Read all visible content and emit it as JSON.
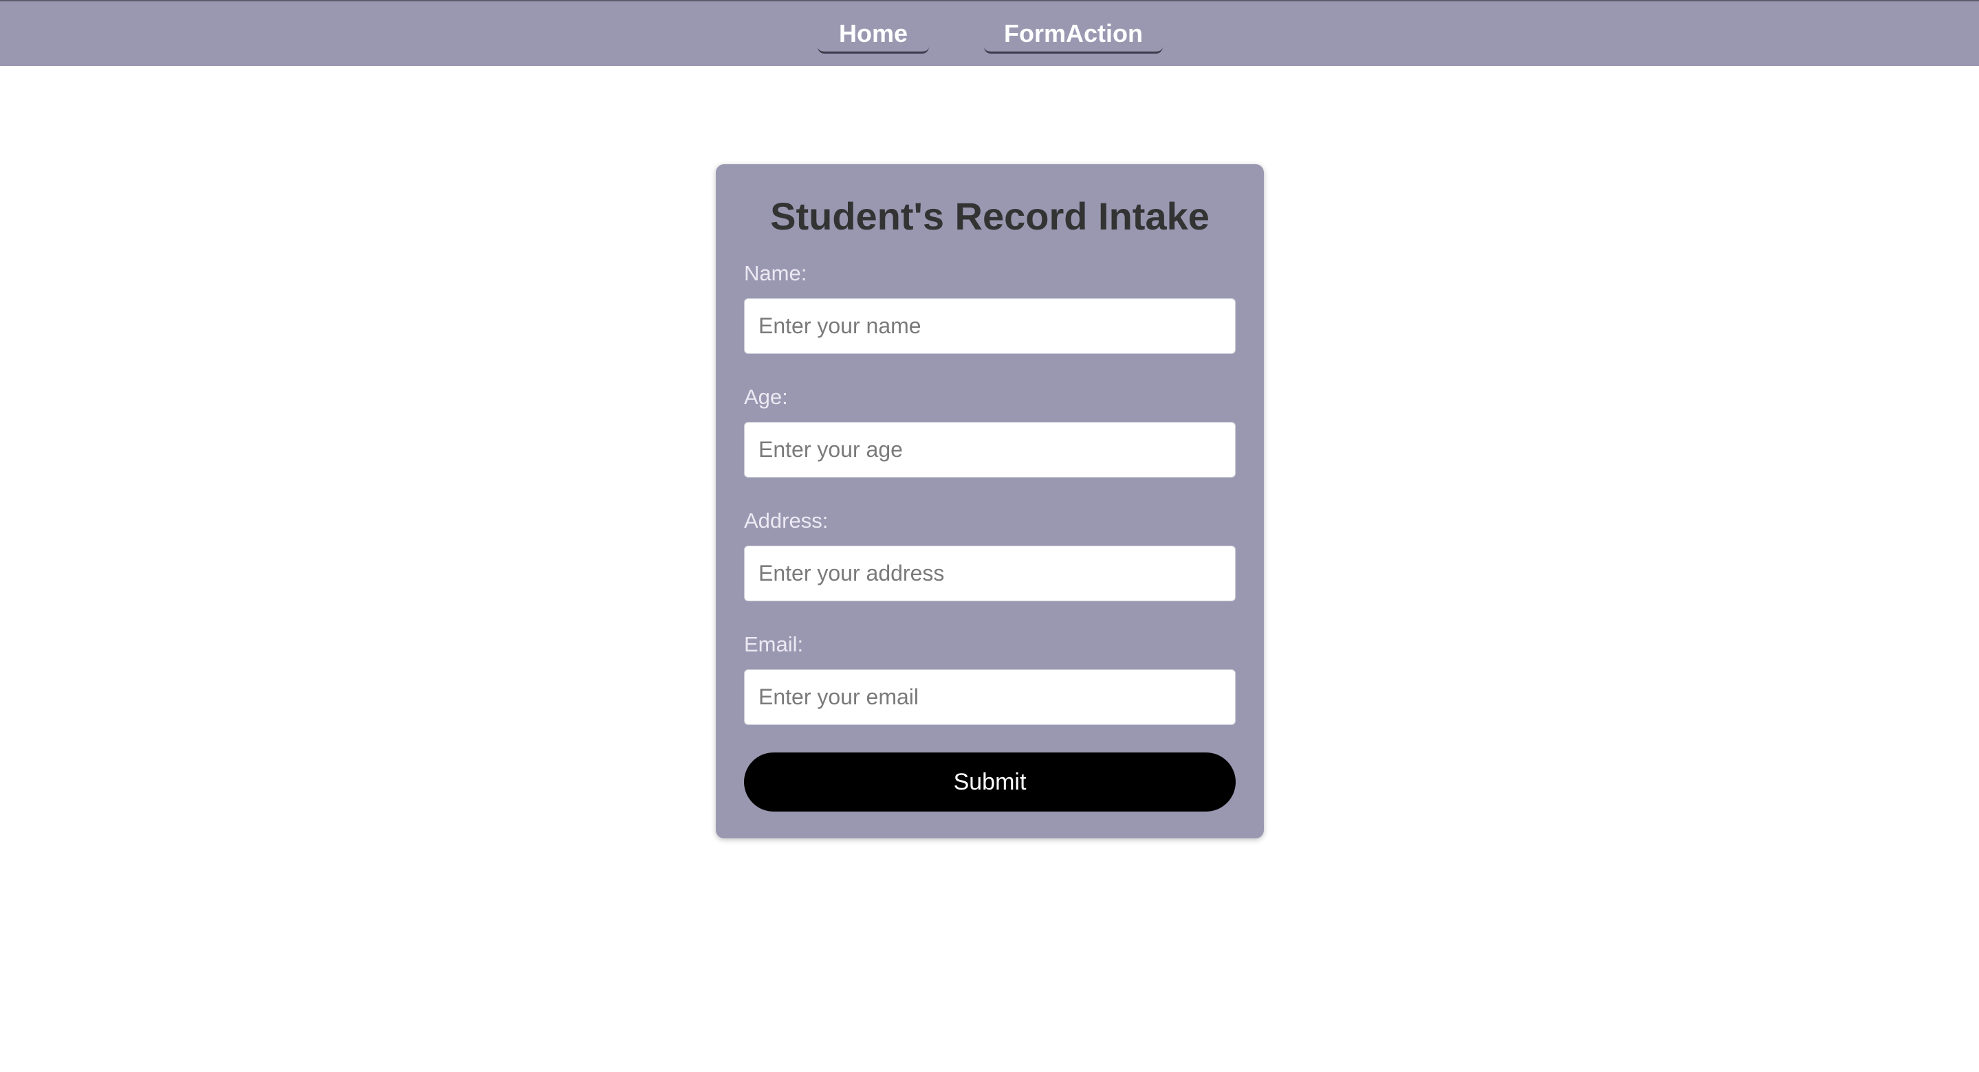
{
  "nav": {
    "home_label": "Home",
    "formaction_label": "FormAction"
  },
  "form": {
    "title": "Student's Record Intake",
    "fields": [
      {
        "label": "Name:",
        "placeholder": "Enter your name",
        "value": ""
      },
      {
        "label": "Age:",
        "placeholder": "Enter your age",
        "value": ""
      },
      {
        "label": "Address:",
        "placeholder": "Enter your address",
        "value": ""
      },
      {
        "label": "Email:",
        "placeholder": "Enter your email",
        "value": ""
      }
    ],
    "submit_label": "Submit"
  },
  "colors": {
    "navbar_bg": "#9a98b1",
    "card_bg": "#9a98b1",
    "button_bg": "#000000",
    "title_text": "#333333",
    "label_text": "#ece9f3"
  }
}
